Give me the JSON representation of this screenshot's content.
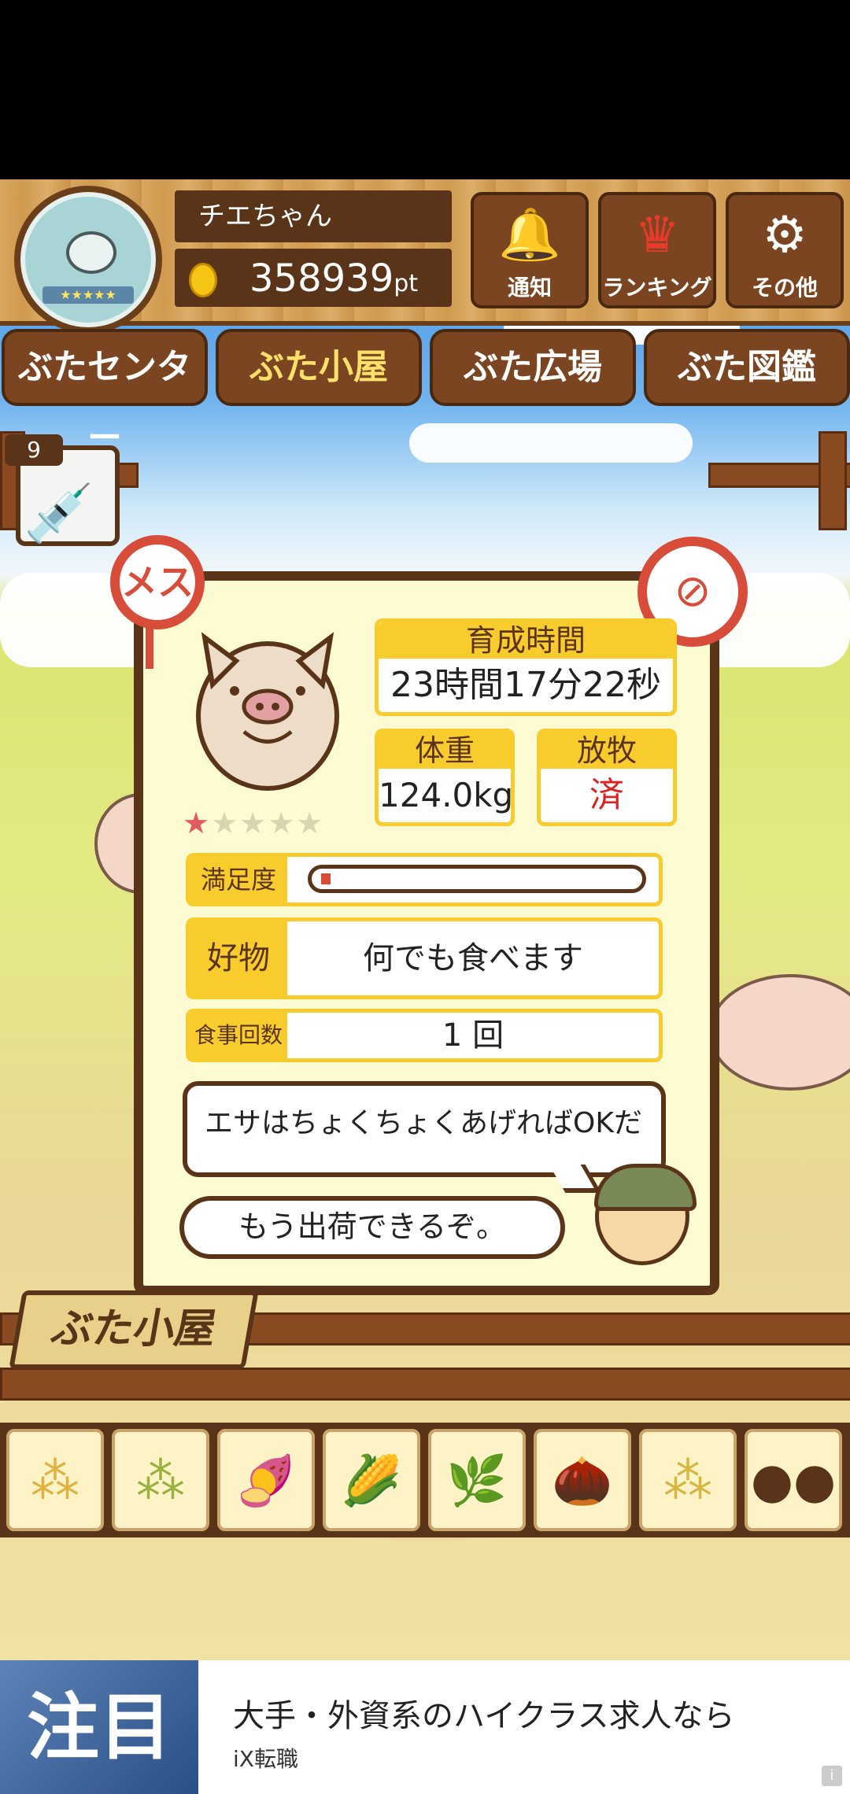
{
  "header": {
    "player_name": "チエちゃん",
    "points_value": "358939",
    "points_unit": "pt",
    "buttons": [
      {
        "label": "通知",
        "icon": "bell-icon"
      },
      {
        "label": "ランキング",
        "icon": "crown-icon"
      },
      {
        "label": "その他",
        "icon": "gear-icon"
      }
    ]
  },
  "tabs": [
    {
      "label": "ぶたセンター",
      "active": false
    },
    {
      "label": "ぶた小屋",
      "active": true
    },
    {
      "label": "ぶた広場",
      "active": false
    },
    {
      "label": "ぶた図鑑",
      "active": false
    }
  ],
  "items": {
    "syringe_count": "9"
  },
  "pig": {
    "gender_badge": "メス",
    "stars_filled": 1,
    "stars_total": 5,
    "grow_time_label": "育成時間",
    "grow_time_value": "23時間17分22秒",
    "weight_label": "体重",
    "weight_value": "124.0kg",
    "pasture_label": "放牧",
    "pasture_value": "済",
    "satisfaction_label": "満足度",
    "satisfaction_level": 0.03,
    "favorite_label": "好物",
    "favorite_value": "何でも食べます",
    "meals_label": "食事回数",
    "meals_value": "1 回"
  },
  "dialog": {
    "line1": "エサはちょくちょくあげればOKだ",
    "line2": "もう出荷できるぞ。"
  },
  "location_sign": "ぶた小屋",
  "foods": [
    "grain-pile-icon",
    "mixed-grain-icon",
    "sweet-potato-icon",
    "corn-icon",
    "soybean-icon",
    "acorn-icon",
    "grain-plate-icon",
    "meatball-plate-icon"
  ],
  "ad": {
    "badge": "注目",
    "title": "大手・外資系のハイクラス求人なら",
    "sponsor": "iX転職"
  },
  "colors": {
    "wood_dark": "#5a3419",
    "accent_yellow": "#f9cc2e",
    "badge_red": "#d84c3a"
  }
}
